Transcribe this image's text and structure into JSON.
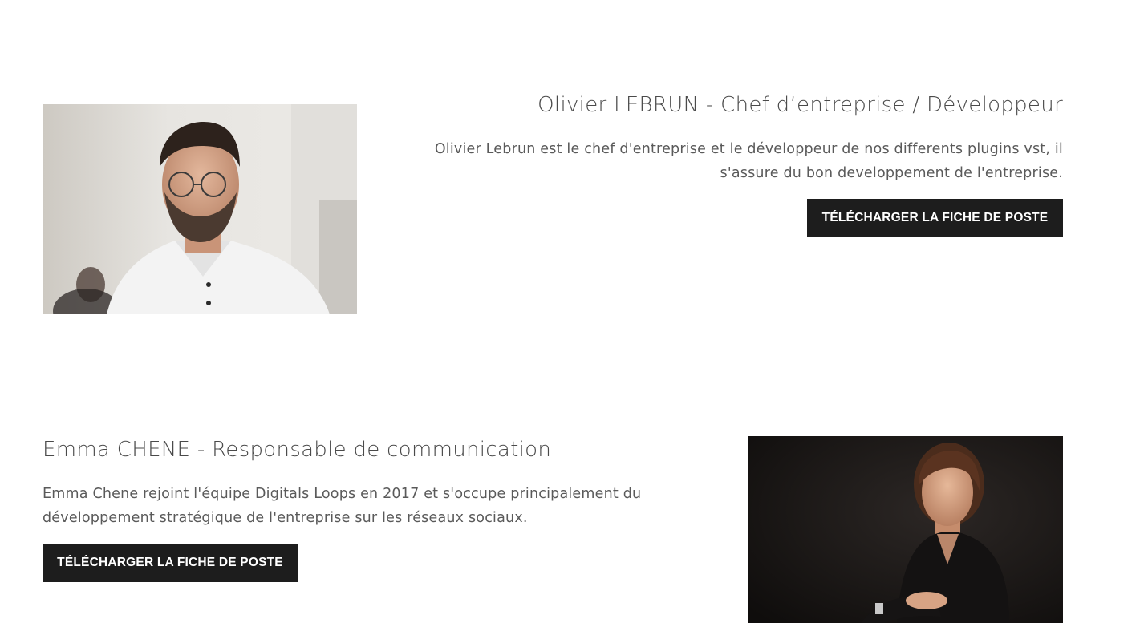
{
  "members": [
    {
      "title": "Olivier LEBRUN - Chef d’entreprise / Développeur",
      "description": "Olivier Lebrun est le chef d'entreprise et le développeur de nos differents plugins vst, il s'assure du bon developpement de l'entreprise.",
      "button_label": "TÉLÉCHARGER LA FICHE DE POSTE"
    },
    {
      "title": "Emma CHENE - Responsable de communication",
      "description": "Emma Chene rejoint l'équipe Digitals Loops en 2017 et s'occupe principalement du développement stratégique de l'entreprise sur les réseaux sociaux.",
      "button_label": "TÉLÉCHARGER LA FICHE DE POSTE"
    }
  ],
  "colors": {
    "button_bg": "#1d1d1d",
    "button_text": "#ffffff",
    "text": "#4a4a4a",
    "background": "#ffffff"
  }
}
